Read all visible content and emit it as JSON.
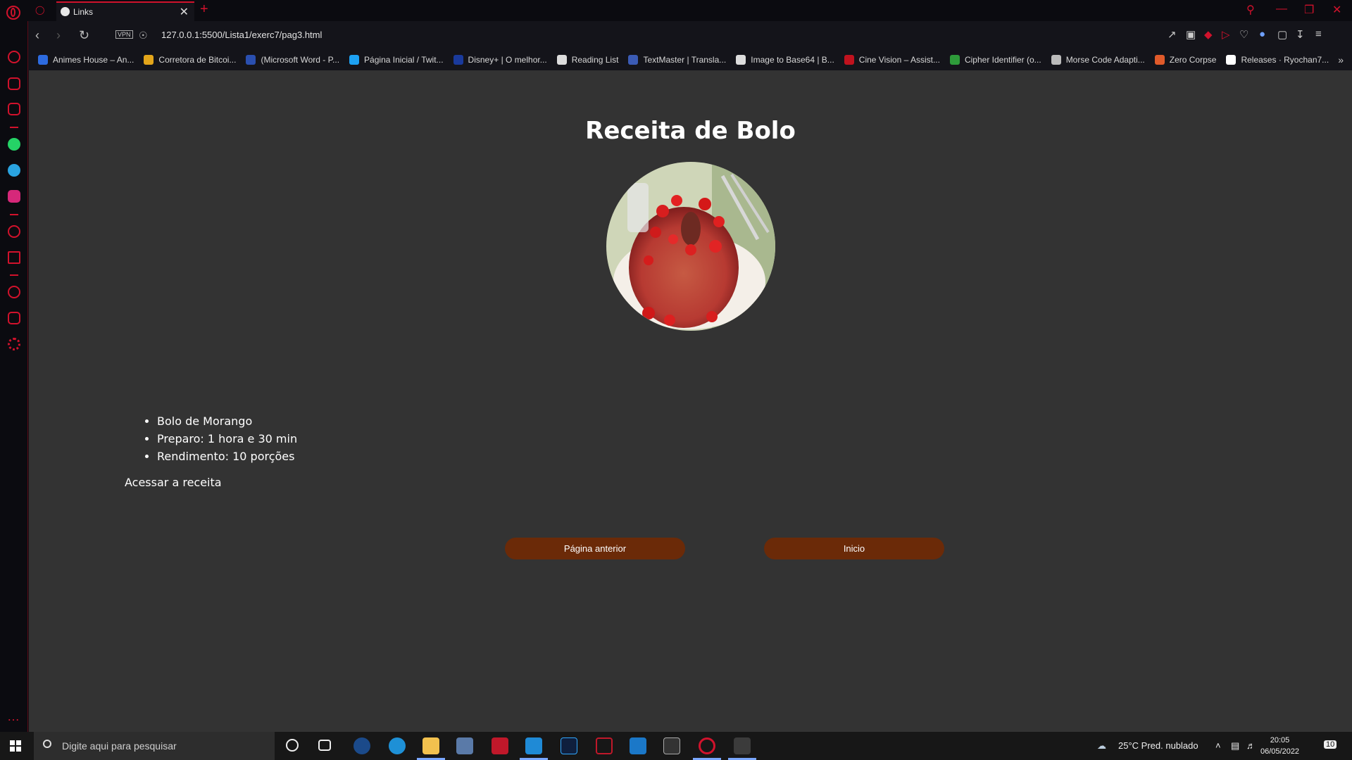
{
  "browser": {
    "tab_title": "Links",
    "url": "127.0.0.1:5500/Lista1/exerc7/pag3.html",
    "vpn_label": "VPN"
  },
  "bookmarks": [
    {
      "label": "Animes House – An...",
      "color": "#2d6be0"
    },
    {
      "label": "Corretora de Bitcoi...",
      "color": "#e3a51a"
    },
    {
      "label": "(Microsoft Word - P...",
      "color": "#2a4fb0"
    },
    {
      "label": "Página Inicial / Twit...",
      "color": "#1da1f2"
    },
    {
      "label": "Disney+ | O melhor...",
      "color": "#1a3a9c"
    },
    {
      "label": "Reading List",
      "color": "#dddddd"
    },
    {
      "label": "TextMaster | Transla...",
      "color": "#3b5bb5"
    },
    {
      "label": "Image to Base64 | B...",
      "color": "#dddddd"
    },
    {
      "label": "Cine Vision – Assist...",
      "color": "#c0121e"
    },
    {
      "label": "Cipher Identifier (o...",
      "color": "#2e9b3a"
    },
    {
      "label": "Morse Code Adapti...",
      "color": "#bbbbbb"
    },
    {
      "label": "Zero Corpse",
      "color": "#e05a2a"
    },
    {
      "label": "Releases · Ryochan7...",
      "color": "#ffffff"
    }
  ],
  "page": {
    "title": "Receita de Bolo",
    "items": [
      "Bolo de Morango",
      "Preparo: 1 hora e 30 min",
      "Rendimento: 10 porções"
    ],
    "recipe_link": "Acessar a receita",
    "prev_button": "Página anterior",
    "home_button": "Inicio",
    "button_color": "#6b2a08"
  },
  "taskbar": {
    "search_placeholder": "Digite aqui para pesquisar",
    "weather": "25°C  Pred. nublado",
    "time": "20:05",
    "date": "06/05/2022",
    "notifications": "10"
  }
}
